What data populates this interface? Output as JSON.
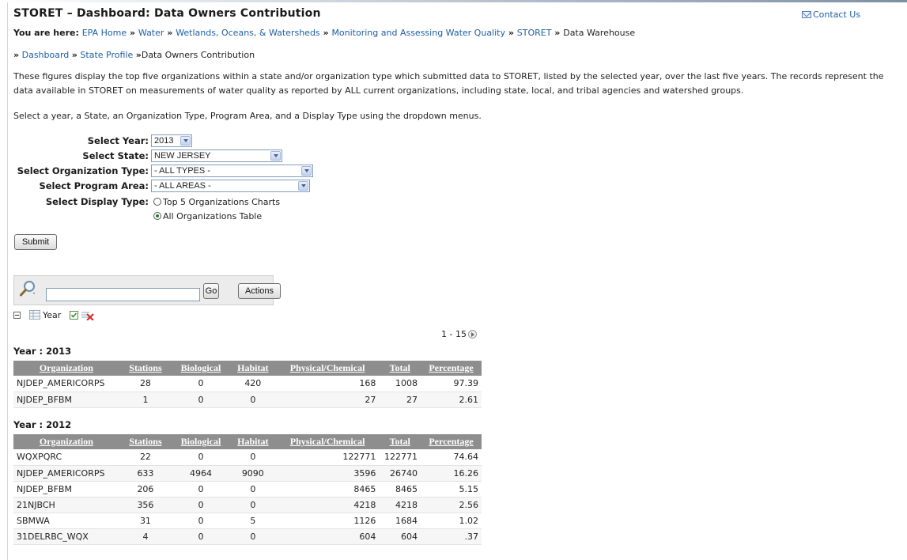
{
  "header": {
    "title": "STORET – Dashboard: Data Owners Contribution",
    "contact_label": "Contact Us"
  },
  "breadcrumb": {
    "label": "You are here",
    "items": [
      "EPA Home",
      "Water",
      "Wetlands, Oceans, & Watersheds",
      "Monitoring and Assessing Water Quality",
      "STORET"
    ],
    "current": "Data Warehouse"
  },
  "subnav": {
    "items": [
      "Dashboard",
      "State Profile"
    ],
    "current": "Data Owners Contribution"
  },
  "intro": "These figures display the top five organizations within a state and/or organization type which submitted data to STORET, listed by the selected year, over the last five years. The records represent the data available in STORET on measurements of water quality as reported by ALL current organizations, including state, local, and tribal agencies and watershed groups.",
  "instructions": "Select a year, a State, an Organization Type, Program Area, and a Display Type using the dropdown menus.",
  "form": {
    "year_label": "Select Year:",
    "year_value": "2013",
    "state_label": "Select State:",
    "state_value": "NEW JERSEY",
    "orgtype_label": "Select Organization Type:",
    "orgtype_value": "- ALL TYPES -",
    "area_label": "Select Program Area:",
    "area_value": "- ALL AREAS -",
    "display_label": "Select Display Type:",
    "display_options": [
      "Top 5 Organizations Charts",
      "All Organizations Table"
    ],
    "display_selected": "All Organizations Table",
    "submit_label": "Submit"
  },
  "report_toolbar": {
    "search_value": "",
    "go_label": "Go",
    "actions_label": "Actions",
    "filter_label": "Year",
    "pagination": "1 - 15"
  },
  "columns": [
    "Organization",
    "Stations",
    "Biological",
    "Habitat",
    "Physical/Chemical",
    "Total",
    "Percentage"
  ],
  "groups": [
    {
      "heading": "Year : 2013",
      "rows": [
        [
          "NJDEP_AMERICORPS",
          "28",
          "0",
          "420",
          "168",
          "1008",
          "97.39"
        ],
        [
          "NJDEP_BFBM",
          "1",
          "0",
          "0",
          "27",
          "27",
          "2.61"
        ]
      ]
    },
    {
      "heading": "Year : 2012",
      "rows": [
        [
          "WQXPQRC",
          "22",
          "0",
          "0",
          "122771",
          "122771",
          "74.64"
        ],
        [
          "NJDEP_AMERICORPS",
          "633",
          "4964",
          "9090",
          "3596",
          "26740",
          "16.26"
        ],
        [
          "NJDEP_BFBM",
          "206",
          "0",
          "0",
          "8465",
          "8465",
          "5.15"
        ],
        [
          "21NJBCH",
          "356",
          "0",
          "0",
          "4218",
          "4218",
          "2.56"
        ],
        [
          "SBMWA",
          "31",
          "0",
          "5",
          "1126",
          "1684",
          "1.02"
        ],
        [
          "31DELRBC_WQX",
          "4",
          "0",
          "0",
          "604",
          "604",
          ".37"
        ]
      ]
    }
  ]
}
